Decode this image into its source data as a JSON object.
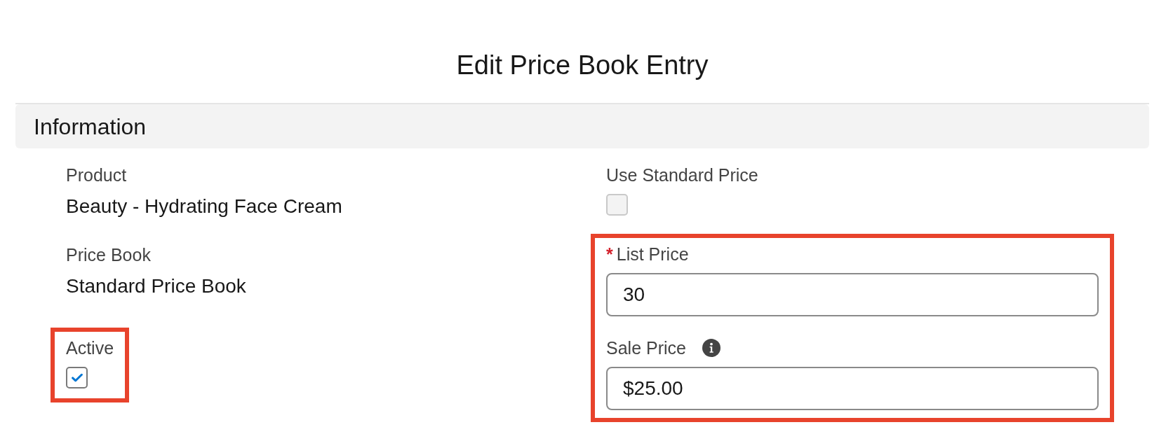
{
  "modal": {
    "title": "Edit Price Book Entry"
  },
  "section": {
    "title": "Information"
  },
  "left_fields": [
    {
      "kind": "text",
      "label": "Product",
      "value": "Beauty - Hydrating Face Cream",
      "help": false,
      "highlighted": false
    },
    {
      "kind": "text",
      "label": "Price Book",
      "value": "Standard Price Book",
      "help": false,
      "highlighted": false
    },
    {
      "kind": "checkbox",
      "label": "Active",
      "checked": true,
      "disabled": false,
      "help": false,
      "highlighted": true
    }
  ],
  "right_fields": [
    {
      "kind": "checkbox",
      "label": "Use Standard Price",
      "checked": false,
      "disabled": true,
      "help": false,
      "highlighted": false
    },
    {
      "kind": "input",
      "label": "List Price",
      "required_mark": "*",
      "value": "30",
      "help": false,
      "highlighted": true
    },
    {
      "kind": "input",
      "label": "Sale Price",
      "value": "$25.00",
      "help": true,
      "highlighted": true
    }
  ]
}
